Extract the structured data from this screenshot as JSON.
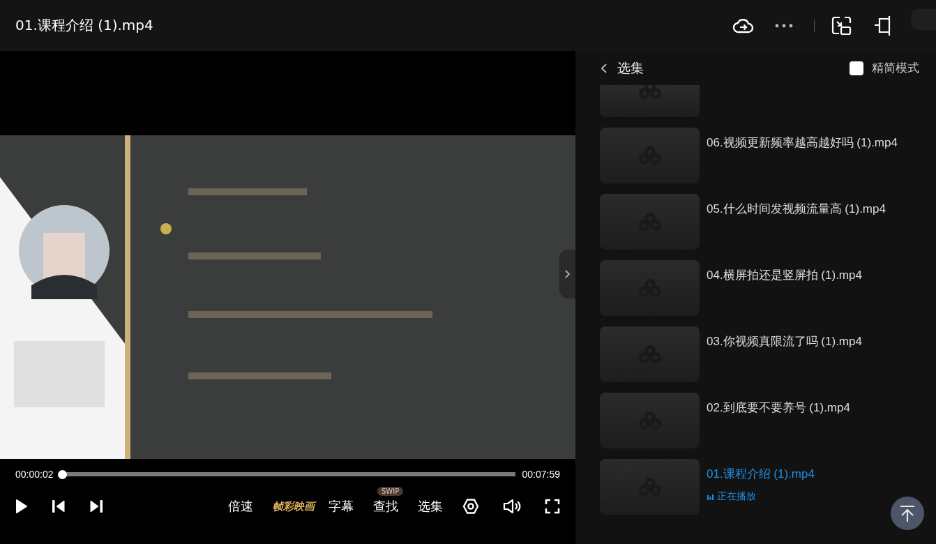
{
  "window": {
    "title": "01.课程介绍 (1).mp4"
  },
  "player": {
    "playing": false,
    "current_time": "00:00:02",
    "duration": "00:07:59",
    "level": 0.004,
    "controls": [
      {
        "kind": "text",
        "label": "倍速"
      },
      {
        "kind": "brand",
        "label": "帧彩映画"
      },
      {
        "kind": "text",
        "label": "字幕"
      },
      {
        "kind": "badged",
        "label": "查找",
        "badge": "SWIP"
      },
      {
        "kind": "text",
        "label": "选集"
      }
    ]
  },
  "sidebar": {
    "title": "选集",
    "simple_mode": {
      "label": "精简模式",
      "checked": false
    },
    "items": [
      {
        "kind": "partial",
        "selected": false
      },
      {
        "kind": "episode",
        "title": "06.视频更新频率越高越好吗 (1).mp4",
        "selected": false
      },
      {
        "kind": "episode",
        "title": "05.什么时间发视频流量高 (1).mp4",
        "selected": false
      },
      {
        "kind": "episode",
        "title": "04.横屏拍还是竖屏拍 (1).mp4",
        "selected": false
      },
      {
        "kind": "episode",
        "title": "03.你视频真限流了吗 (1).mp4",
        "selected": false
      },
      {
        "kind": "episode",
        "title": "02.到底要不要养号 (1).mp4",
        "selected": false
      },
      {
        "kind": "episode",
        "title": "01.课程介绍 (1).mp4",
        "selected": true,
        "status": "正在播放"
      }
    ]
  }
}
